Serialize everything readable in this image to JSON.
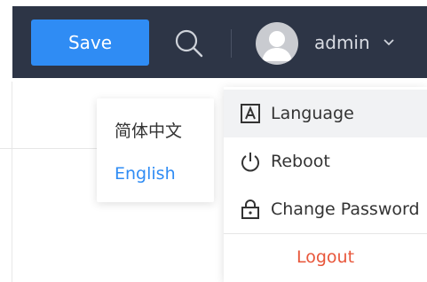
{
  "toolbar": {
    "save_label": "Save",
    "search_icon": "search-icon"
  },
  "user": {
    "name": "admin",
    "avatar_icon": "user-avatar-icon",
    "chevron_icon": "chevron-down-icon"
  },
  "language_menu": {
    "items": [
      {
        "label": "简体中文",
        "selected": false
      },
      {
        "label": "English",
        "selected": true
      }
    ]
  },
  "user_dropdown": {
    "items": [
      {
        "label": "Language",
        "icon": "language-icon",
        "active": true
      },
      {
        "label": "Reboot",
        "icon": "power-icon",
        "active": false
      },
      {
        "label": "Change Password",
        "icon": "lock-icon",
        "active": false
      }
    ],
    "logout_label": "Logout"
  },
  "colors": {
    "topbar": "#2d3546",
    "primary": "#2f8cf4",
    "danger": "#e8563a",
    "hover": "#f1f2f4"
  }
}
